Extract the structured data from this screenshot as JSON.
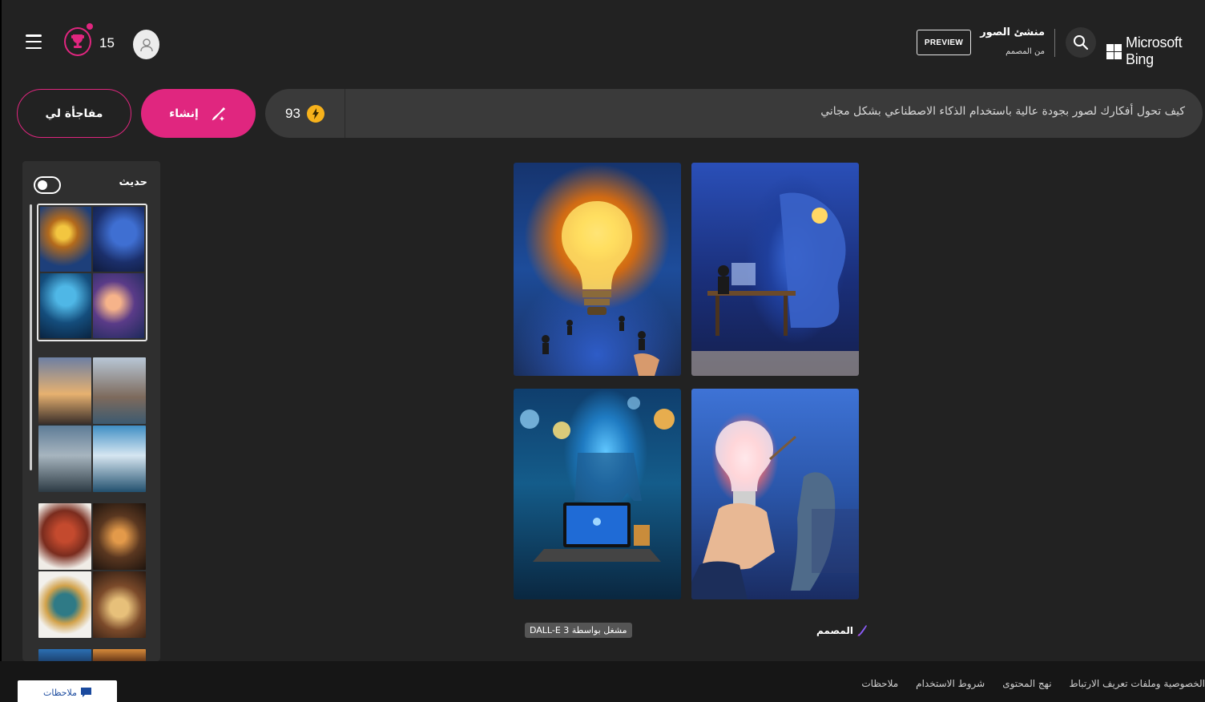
{
  "header": {
    "points": "15",
    "brand": "Microsoft Bing",
    "app_title": "منشئ الصور",
    "app_subtitle": "من المصمم",
    "preview_label": "PREVIEW"
  },
  "prompt": {
    "surprise_label": "مفاجأة لي",
    "create_label": "إنشاء",
    "boost_count": "93",
    "placeholder_text": "كيف تحول أفكارك لصور بجودة عالية باستخدام الذكاء الاصطناعي بشكل مجاني"
  },
  "sidebar": {
    "recent_label": "حديث"
  },
  "results": {
    "powered_by": "مشغل بواسطة DALL-E 3",
    "designer_label": "المصمم"
  },
  "footer": {
    "feedback_label": "ملاحظات",
    "links": [
      "الخصوصية وملفات تعريف الارتباط",
      "نهج المحتوى",
      "شروط الاستخدام",
      "ملاحظات"
    ]
  },
  "colors": {
    "accent": "#e0267f",
    "background": "#222222",
    "coin": "#f7b21b"
  }
}
